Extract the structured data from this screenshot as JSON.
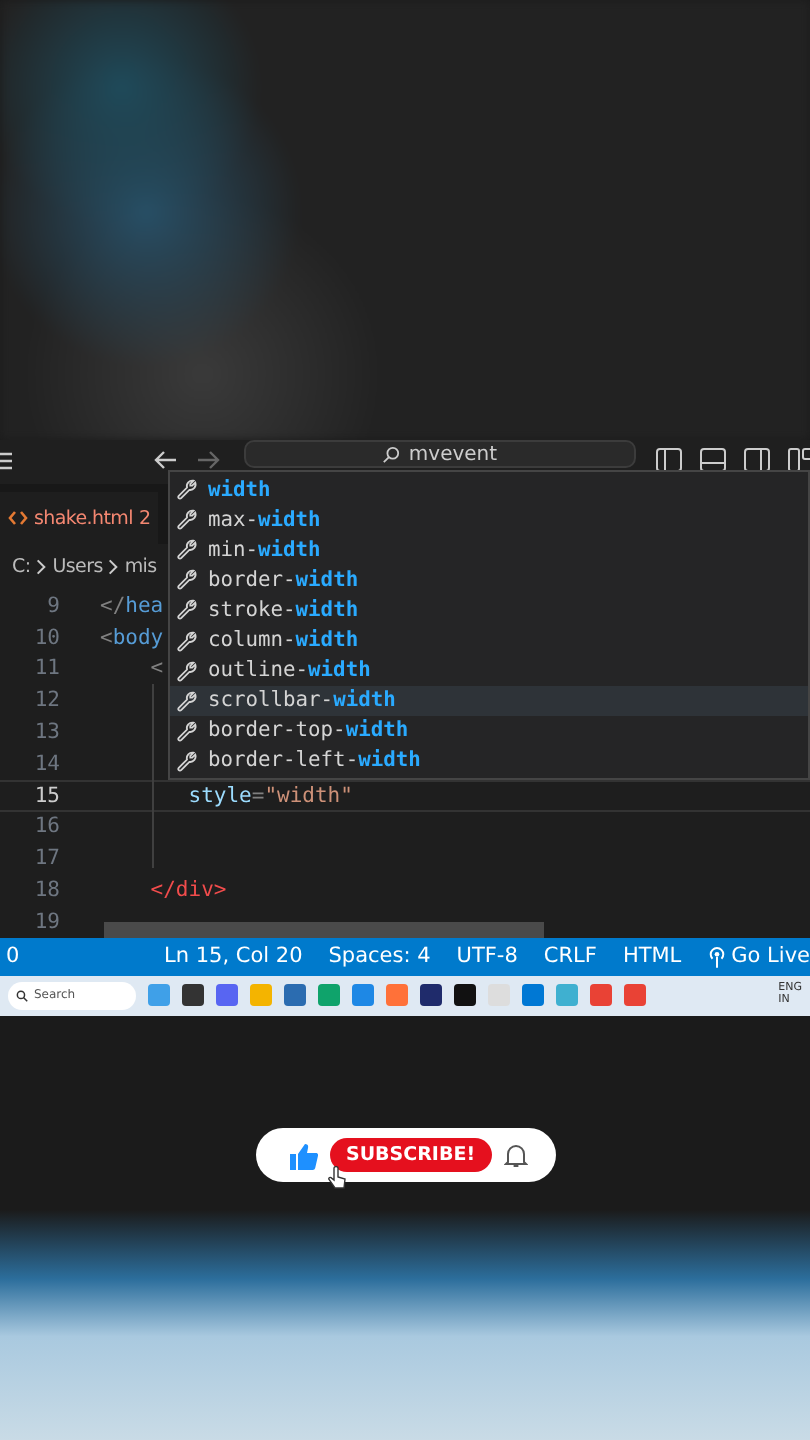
{
  "title_bar": {
    "search": "mvevent"
  },
  "tab": {
    "label": "shake.html",
    "problems": "2"
  },
  "breadcrumb": [
    "C:",
    "Users",
    "mis"
  ],
  "editor": {
    "lines": [
      {
        "number": "9",
        "current": false,
        "tokens": [
          {
            "kind": "punct",
            "text": "</"
          },
          {
            "kind": "tag",
            "text": "hea"
          }
        ]
      },
      {
        "number": "10",
        "current": false,
        "tokens": [
          {
            "kind": "punct",
            "text": "<"
          },
          {
            "kind": "tag",
            "text": "body"
          }
        ]
      },
      {
        "number": "11",
        "current": false,
        "tokens": [
          {
            "kind": "punct",
            "text": "    <"
          }
        ]
      },
      {
        "number": "12",
        "current": false
      },
      {
        "number": "13",
        "current": false
      },
      {
        "number": "14",
        "current": false
      },
      {
        "number": "15",
        "current": true,
        "tokens": [
          {
            "kind": "attr",
            "text": "       style"
          },
          {
            "kind": "punct",
            "text": "="
          },
          {
            "kind": "string",
            "text": "\"width\""
          }
        ]
      },
      {
        "number": "16",
        "current": false
      },
      {
        "number": "17",
        "current": false
      },
      {
        "number": "18",
        "current": false,
        "tokens": [
          {
            "kind": "error",
            "text": "    </div>"
          }
        ]
      },
      {
        "number": "19",
        "current": false
      }
    ]
  },
  "suggestions": [
    {
      "match": "width",
      "selected": false
    },
    {
      "prefix": "max-",
      "match": "width",
      "selected": false
    },
    {
      "prefix": "min-",
      "match": "width",
      "selected": false
    },
    {
      "prefix": "border-",
      "match": "width",
      "selected": false
    },
    {
      "prefix": "stroke-",
      "match": "width",
      "selected": false
    },
    {
      "prefix": "column-",
      "match": "width",
      "selected": false
    },
    {
      "prefix": "outline-",
      "match": "width",
      "selected": false
    },
    {
      "prefix": "scrollbar-",
      "match": "width",
      "selected": true
    },
    {
      "prefix": "border-top-",
      "match": "width",
      "selected": false
    },
    {
      "prefix": "border-left-",
      "match": "width",
      "selected": false
    }
  ],
  "status_bar": {
    "problems": "0",
    "items": [
      "Ln 15, Col 20",
      "Spaces: 4",
      "UTF-8",
      "CRLF",
      "HTML"
    ],
    "go_live": "Go Live"
  },
  "taskbar": {
    "search_placeholder": "Search",
    "language": [
      "ENG",
      "IN"
    ]
  },
  "subscribe": {
    "label": "SUBSCRIBE!"
  }
}
